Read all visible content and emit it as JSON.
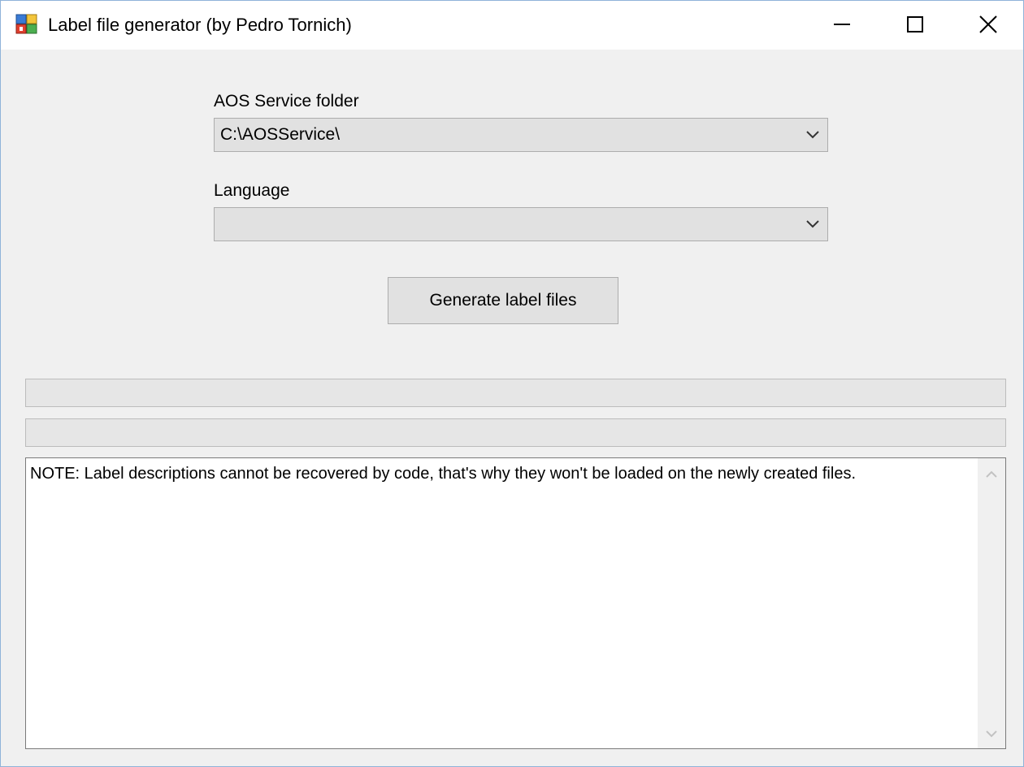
{
  "window": {
    "title": "Label file generator (by Pedro Tornich)",
    "controls": {
      "minimize": "minimize-icon",
      "maximize": "maximize-icon",
      "close": "close-icon"
    }
  },
  "form": {
    "aos_label": "AOS Service folder",
    "aos_value": "C:\\AOSService\\",
    "language_label": "Language",
    "language_value": "",
    "generate_button": "Generate label files"
  },
  "progress": {
    "bar1_fraction": 0,
    "bar2_fraction": 0
  },
  "log": {
    "text": "NOTE: Label descriptions cannot be recovered by code, that's why they won't be loaded on the newly created files."
  },
  "colors": {
    "window_bg": "#f0f0f0",
    "control_bg": "#e1e1e1",
    "progress_fill": "#06b025"
  }
}
